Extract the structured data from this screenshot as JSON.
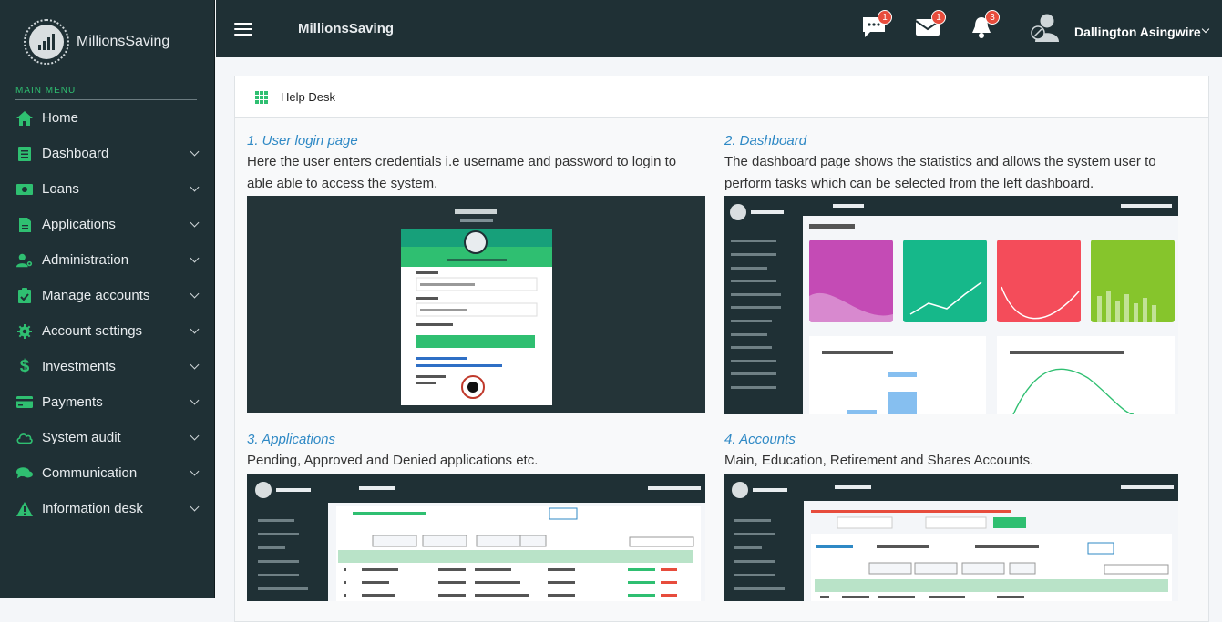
{
  "app": {
    "brand": "MillionsSaving",
    "title": "MillionsSaving"
  },
  "sidebar": {
    "menu_label": "MAIN MENU",
    "items": [
      {
        "label": "Home",
        "icon": "home-icon",
        "chev": false
      },
      {
        "label": "Dashboard",
        "icon": "dashboard-icon",
        "chev": true
      },
      {
        "label": "Loans",
        "icon": "money-icon",
        "chev": true
      },
      {
        "label": "Applications",
        "icon": "file-icon",
        "chev": true
      },
      {
        "label": "Administration",
        "icon": "user-cog-icon",
        "chev": true
      },
      {
        "label": "Manage accounts",
        "icon": "clipboard-check-icon",
        "chev": true
      },
      {
        "label": "Account settings",
        "icon": "gear-icon",
        "chev": true
      },
      {
        "label": "Investments",
        "icon": "dollar-icon",
        "chev": true
      },
      {
        "label": "Payments",
        "icon": "credit-card-icon",
        "chev": true
      },
      {
        "label": "System audit",
        "icon": "cloud-icon",
        "chev": true
      },
      {
        "label": "Communication",
        "icon": "comments-icon",
        "chev": true
      },
      {
        "label": "Information desk",
        "icon": "info-icon",
        "chev": true
      }
    ]
  },
  "topbar": {
    "messages_count": "1",
    "mail_count": "1",
    "notifications_count": "3",
    "user_name": "Dallington Asingwire"
  },
  "helpdesk": {
    "title": "Help Desk",
    "sections": [
      {
        "title": "1. User login page",
        "text": "Here the user enters credentials i.e username and password to login to able able to access the system."
      },
      {
        "title": "2. Dashboard",
        "text": "The dashboard page shows the statistics and allows the system user to perform tasks which can be selected from the left dashboard."
      },
      {
        "title": "3. Applications",
        "text": "Pending, Approved and Denied applications etc."
      },
      {
        "title": "4. Accounts",
        "text": "Main, Education, Retirement and Shares Accounts."
      }
    ]
  },
  "colors": {
    "sidebar_bg": "#1f3035",
    "accent": "#2fbf71",
    "link": "#2f89c5",
    "badge": "#e74c3c"
  }
}
